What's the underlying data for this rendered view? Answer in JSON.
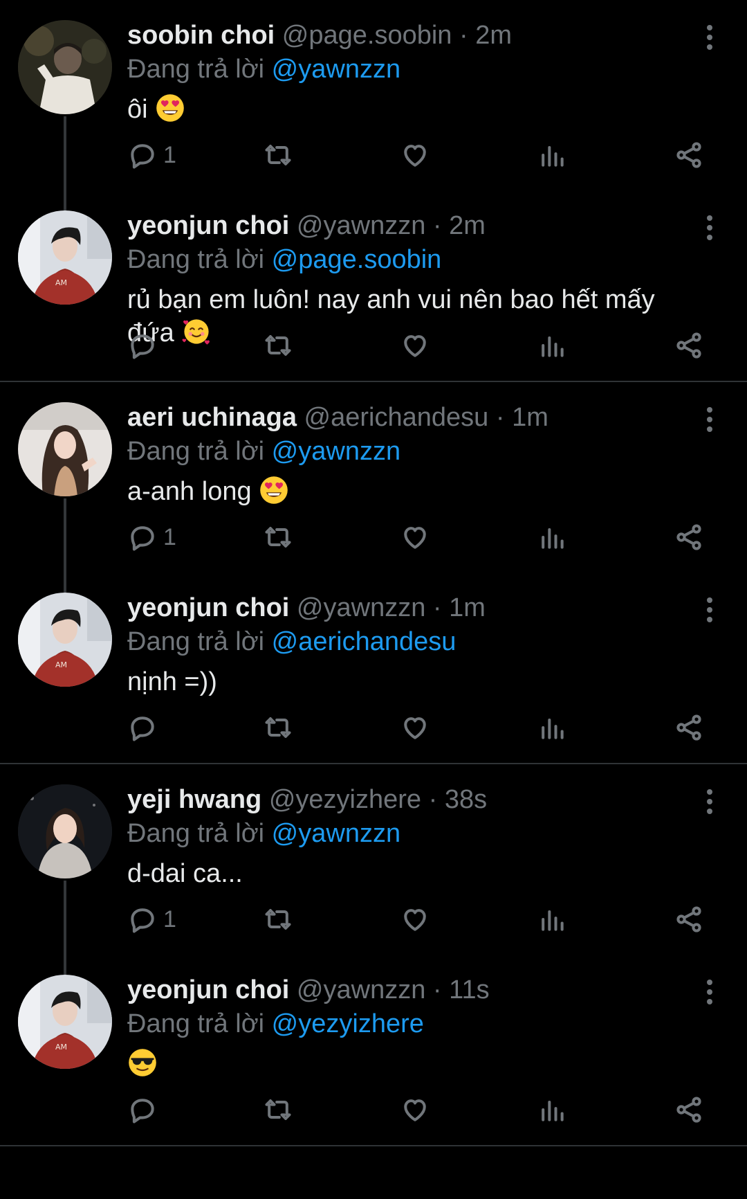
{
  "reply_prefix": "Đang trả lời",
  "groups": [
    {
      "tweets": [
        {
          "name": "soobin choi",
          "handle": "@page.soobin",
          "time": "2m",
          "reply_to": "@yawnzzn",
          "text": "ôi",
          "emoji": "heart-eyes",
          "reply_count": "1",
          "avatar_icon": "avatar-soobin"
        },
        {
          "name": "yeonjun choi",
          "handle": "@yawnzzn",
          "time": "2m",
          "reply_to": "@page.soobin",
          "text": "rủ bạn em luôn! nay anh vui nên bao hết mấy đứa",
          "emoji": "smiling-hearts",
          "reply_count": "",
          "avatar_icon": "avatar-yeonjun"
        }
      ]
    },
    {
      "tweets": [
        {
          "name": "aeri uchinaga",
          "handle": "@aerichandesu",
          "time": "1m",
          "reply_to": "@yawnzzn",
          "text": "a-anh long",
          "emoji": "heart-eyes",
          "reply_count": "1",
          "avatar_icon": "avatar-aeri"
        },
        {
          "name": "yeonjun choi",
          "handle": "@yawnzzn",
          "time": "1m",
          "reply_to": "@aerichandesu",
          "text": "nịnh =))",
          "emoji": "",
          "reply_count": "",
          "avatar_icon": "avatar-yeonjun"
        }
      ]
    },
    {
      "tweets": [
        {
          "name": "yeji hwang",
          "handle": "@yezyizhere",
          "time": "38s",
          "reply_to": "@yawnzzn",
          "text": "d-dai ca...",
          "emoji": "",
          "reply_count": "1",
          "avatar_icon": "avatar-yeji"
        },
        {
          "name": "yeonjun choi",
          "handle": "@yawnzzn",
          "time": "11s",
          "reply_to": "@yezyizhere",
          "text": "",
          "emoji": "sunglasses",
          "reply_count": "",
          "avatar_icon": "avatar-yeonjun"
        }
      ]
    }
  ],
  "colors": {
    "background": "#000000",
    "text": "#e7e9ea",
    "muted": "#71767b",
    "accent": "#1d9bf0",
    "divider": "#2f3336"
  },
  "action_icons": [
    "reply-icon",
    "retweet-icon",
    "like-icon",
    "views-icon",
    "share-icon"
  ]
}
